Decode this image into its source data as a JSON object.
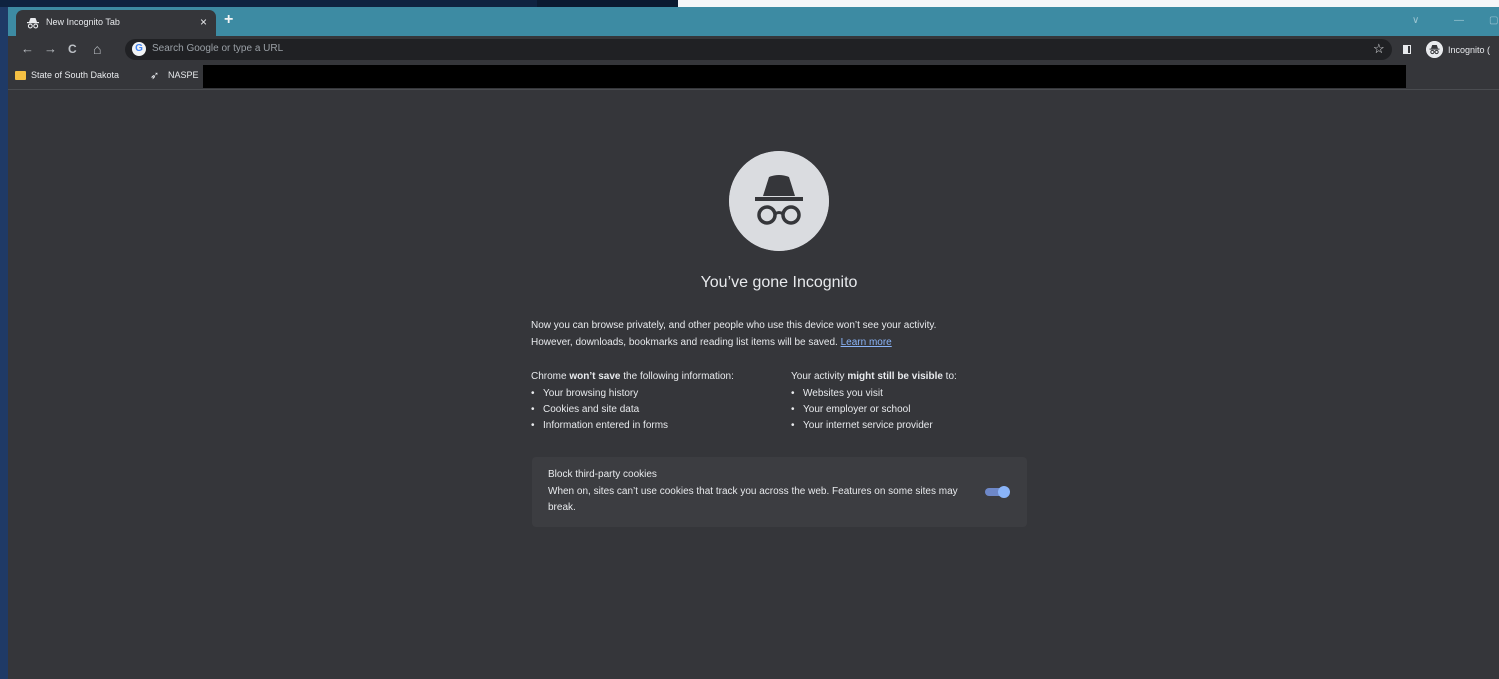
{
  "tab": {
    "title": "New Incognito Tab",
    "close": "×",
    "new_tab": "+"
  },
  "window_controls": {
    "dropdown": "∨",
    "minimize": "—",
    "maximize": "▢"
  },
  "toolbar": {
    "back": "←",
    "forward": "→",
    "reload": "C",
    "home": "⌂",
    "omnibox_placeholder": "Search Google or type a URL",
    "google_badge": "G",
    "star": "☆",
    "profile_label": "Incognito ("
  },
  "bookmarks": [
    {
      "label": "State of South Dakota",
      "icon": "folder-icon"
    },
    {
      "label": "NASPE",
      "icon": "pin-icon"
    }
  ],
  "ntp": {
    "headline": "You’ve gone Incognito",
    "intro_line1": "Now you can browse privately, and other people who use this device won’t see your activity.",
    "intro_line2": "However, downloads, bookmarks and reading list items will be saved.",
    "learn_more": "Learn more",
    "left_col": {
      "title_pre": "Chrome ",
      "title_bold": "won’t save",
      "title_post": " the following information:",
      "items": [
        "Your browsing history",
        "Cookies and site data",
        "Information entered in forms"
      ]
    },
    "right_col": {
      "title_pre": "Your activity ",
      "title_bold": "might still be visible",
      "title_post": " to:",
      "items": [
        "Websites you visit",
        "Your employer or school",
        "Your internet service provider"
      ]
    },
    "cookies": {
      "title": "Block third-party cookies",
      "description": "When on, sites can’t use cookies that track you across the web. Features on some sites may break.",
      "enabled": true
    }
  },
  "colors": {
    "accent_tabstrip": "#3d8ba3",
    "page_bg": "#35363a",
    "link": "#8ab4f8",
    "toggle_on": "#8ab4f8"
  }
}
